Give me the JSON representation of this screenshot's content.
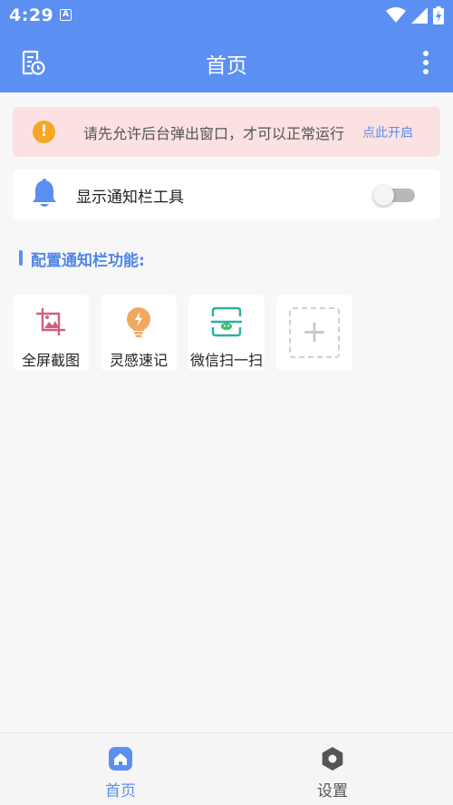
{
  "status_bar": {
    "time": "4:29",
    "notification_badge": "A"
  },
  "app_bar": {
    "title": "首页",
    "left_icon": "history-icon",
    "right_icon": "more-vert-icon"
  },
  "notice": {
    "icon": "warning-icon",
    "text": "请先允许后台弹出窗口，才可以正常运行",
    "action": "点此开启"
  },
  "notification_toggle": {
    "icon": "bell-icon",
    "label": "显示通知栏工具",
    "enabled": false
  },
  "section": {
    "title": "配置通知栏功能:"
  },
  "tools": [
    {
      "label": "全屏截图",
      "icon": "screenshot-icon"
    },
    {
      "label": "灵感速记",
      "icon": "lightbulb-icon"
    },
    {
      "label": "微信扫一扫",
      "icon": "scan-icon"
    }
  ],
  "add_tool": {
    "icon": "plus-icon"
  },
  "bottom_nav": [
    {
      "label": "首页",
      "icon": "home-icon",
      "active": true
    },
    {
      "label": "设置",
      "icon": "settings-icon",
      "active": false
    }
  ],
  "colors": {
    "primary": "#5b8ff2",
    "notice_bg": "#fbe1e1",
    "warning": "#f5a623",
    "background": "#f7f7f7"
  }
}
